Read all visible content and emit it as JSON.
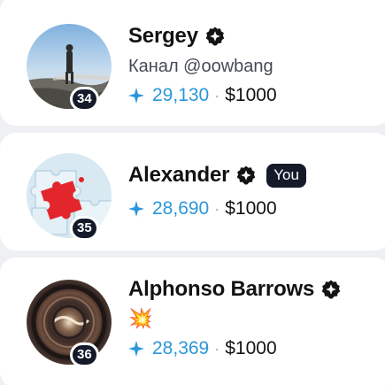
{
  "users": [
    {
      "name": "Sergey",
      "subtitle": "Канал @oowbang",
      "rank": "34",
      "points": "29,130",
      "amount": "$1000",
      "separator": "·"
    },
    {
      "name": "Alexander",
      "you_label": "You",
      "rank": "35",
      "points": "28,690",
      "amount": "$1000",
      "separator": "·"
    },
    {
      "name": "Alphonso Barrows",
      "emoji": "💥",
      "rank": "36",
      "points": "28,369",
      "amount": "$1000",
      "separator": "·"
    }
  ],
  "icons": {
    "verified": "verified-badge-icon",
    "points": "sparkle-star-icon"
  },
  "colors": {
    "points": "#2b97d9",
    "badge": "#141a2a",
    "card": "#ffffff",
    "background": "#eef0f3"
  }
}
